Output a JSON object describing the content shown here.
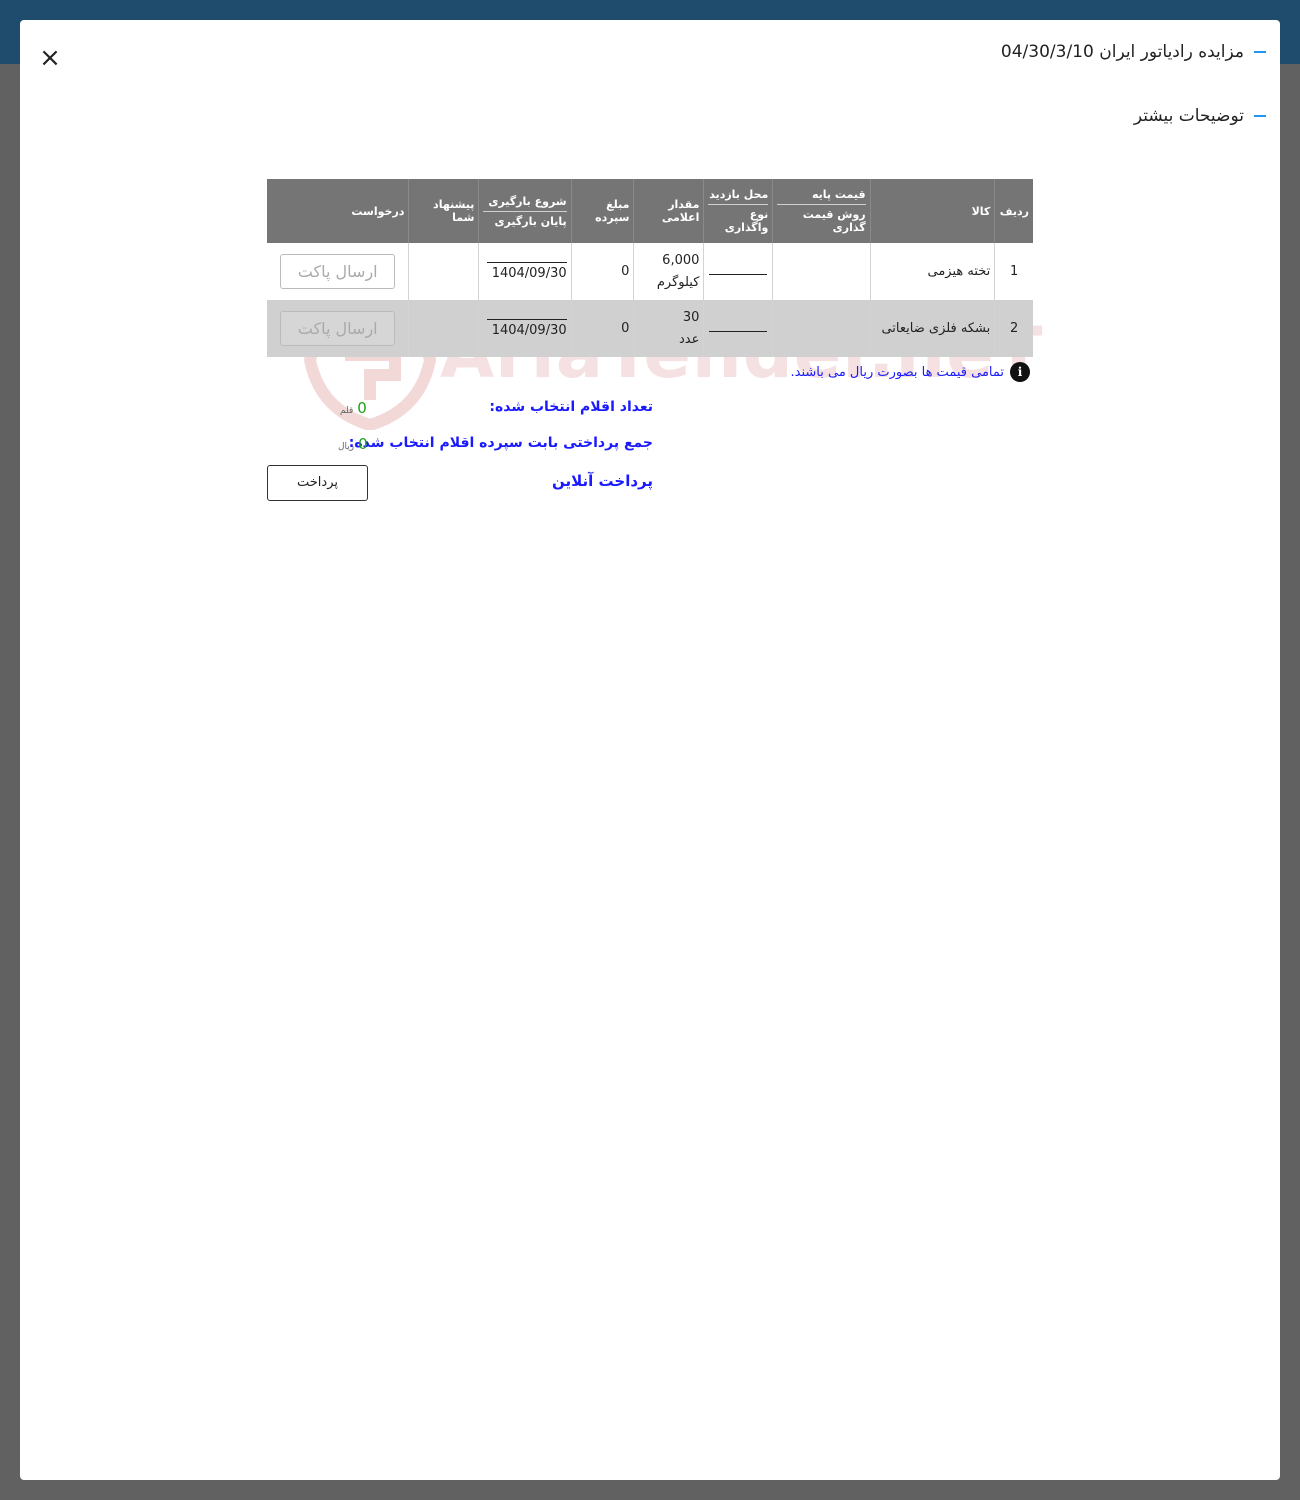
{
  "header": {
    "title": "مزایده رادیاتور ایران 04/30/3/10",
    "more_details": "توضیحات بیشتر",
    "close_label": "×"
  },
  "table": {
    "headers": {
      "row_no": "ردیف",
      "item": "کالا",
      "base_price": "قیمت پایه",
      "pricing_method": "روش قیمت گذاری",
      "visit_place": "محل بازدید",
      "assignment_type": "نوع واگذاری",
      "announced_qty": "مقدار اعلامی",
      "deposit": "مبلغ سپرده",
      "loading_start": "شروع بارگیری",
      "loading_end": "پایان بارگیری",
      "your_offer": "پیشنهاد شما",
      "request": "درخواست"
    },
    "rows": [
      {
        "no": "1",
        "item": "تخته هیزمی",
        "qty": "6,000",
        "unit": "کیلوگرم",
        "deposit": "0",
        "loading_end": "1404/09/30",
        "send_label": "ارسال پاکت"
      },
      {
        "no": "2",
        "item": "بشکه فلزی ضایعاتی",
        "qty": "30",
        "unit": "عدد",
        "deposit": "0",
        "loading_end": "1404/09/30",
        "send_label": "ارسال پاکت"
      }
    ]
  },
  "note": {
    "icon": "info-icon",
    "text": "تمامی قیمت ها بصورت ریال می باشند."
  },
  "summary": {
    "selected_count_label": "تعداد اقلام انتخاب شده:",
    "selected_count_value": "0",
    "selected_count_unit": "قلم",
    "total_deposit_label": "جمع پرداختی بابت سپرده اقلام انتخاب شده:",
    "total_deposit_value": "0",
    "total_deposit_unit": "ریال",
    "online_payment_label": "پرداخت آنلاین",
    "pay_button": "پرداخت"
  },
  "watermark": {
    "text": "AriaTender.neT"
  },
  "colors": {
    "header_bg": "#757575",
    "accent_blue": "#1a1aff",
    "value_green": "#1aa01a",
    "dash_blue": "#2196f3",
    "backdrop": "#616161",
    "topbar": "#1f4b6c"
  }
}
